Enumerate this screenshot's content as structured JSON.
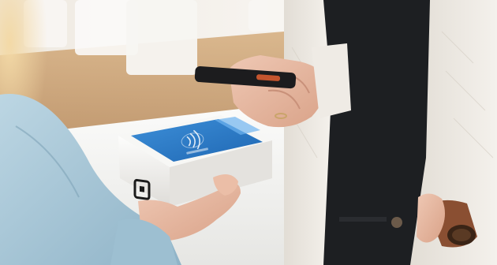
{
  "image": {
    "alt": "",
    "colors": {
      "background_wall": "#f4f1ec",
      "counter_wood": "#c79d6c",
      "counter_white": "#f7f7f5",
      "terminal_body": "#f2f2f0",
      "terminal_screen": "#2f7fc9",
      "terminal_screen_light": "#5aa6e6",
      "phone": "#1c1c1e",
      "skin": "#e7b9a3",
      "left_sleeve": "#a9c8d8",
      "dark_top": "#1d1f22",
      "cardigan": "#ece8e2",
      "cup": "#8a4f32"
    },
    "icons": {
      "terminal_logo": "square-logo-icon",
      "contactless": "contactless-icon"
    }
  }
}
